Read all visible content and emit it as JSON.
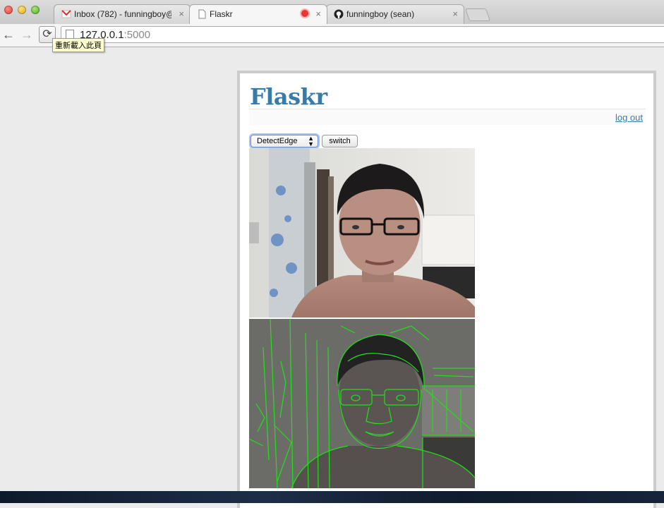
{
  "browser": {
    "tabs": [
      {
        "label": "Inbox (782) - funningboy@",
        "icon": "gmail-icon"
      },
      {
        "label": "Flaskr",
        "icon": "page-icon",
        "active": true,
        "recording": true
      },
      {
        "label": "funningboy (sean)",
        "icon": "github-icon"
      }
    ],
    "url_host": "127.0.0.1",
    "url_port": ":5000",
    "reload_tooltip": "重新載入此頁"
  },
  "page": {
    "brand": "Flaskr",
    "logout": "log out",
    "filter_select": {
      "selected": "DetectEdge"
    },
    "switch_label": "switch"
  },
  "colors": {
    "brand": "#377ba8",
    "edge": "#22e01a"
  }
}
